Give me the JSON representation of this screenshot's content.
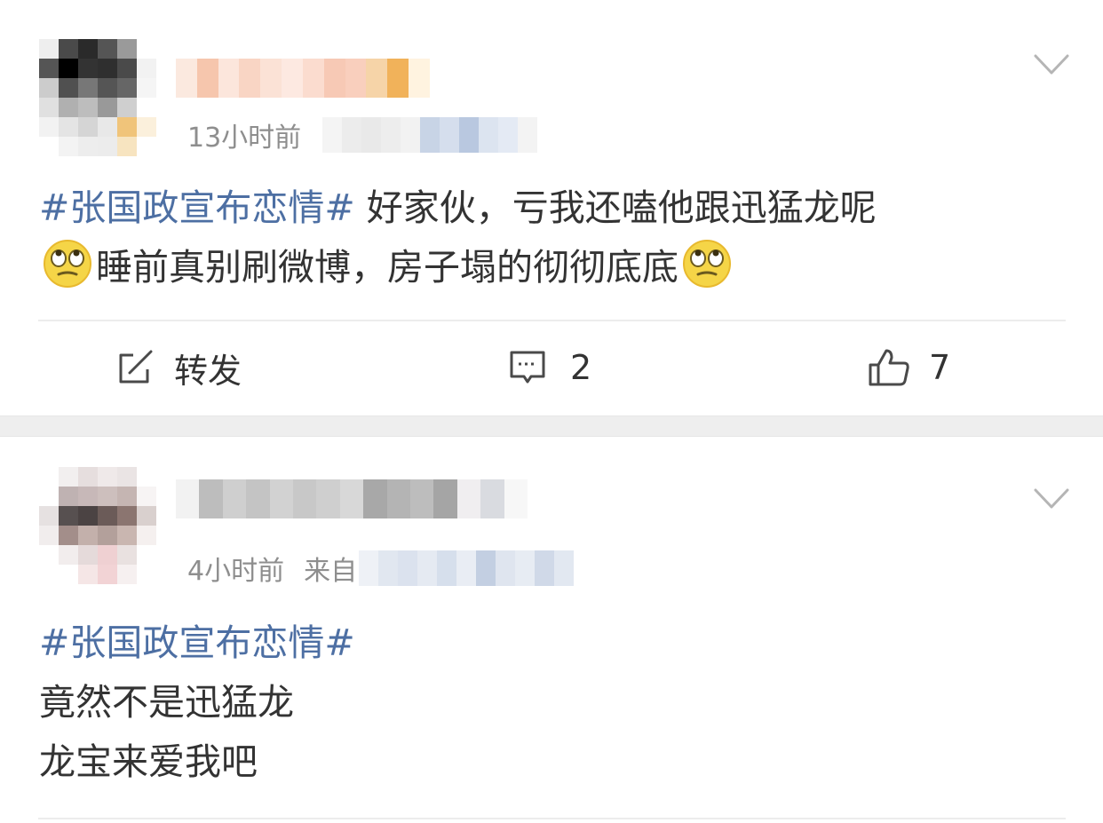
{
  "posts": [
    {
      "time": "13小时前",
      "source_label": "",
      "body": {
        "topic": "#张国政宣布恋情#",
        "line1_rest": " 好家伙，亏我还嗑他跟迅猛龙呢",
        "line2": "睡前真别刷微博，房子塌的彻彻底底"
      },
      "emoji": "eye-roll-emoji",
      "actions": {
        "repost": "转发",
        "comments": "2",
        "likes": "7"
      }
    },
    {
      "time": "4小时前",
      "source_label": "来自",
      "body": {
        "topic": "#张国政宣布恋情#",
        "line2": "竟然不是迅猛龙",
        "line3": "龙宝来爱我吧"
      }
    }
  ],
  "icons": {
    "more": "chevron-down-icon",
    "repost": "repost-icon",
    "comment": "comment-icon",
    "like": "thumbs-up-icon"
  },
  "colors": {
    "topic_link": "#4d6fa3",
    "text": "#333333",
    "meta": "#8e8e8e",
    "separator": "#eeeeee"
  }
}
